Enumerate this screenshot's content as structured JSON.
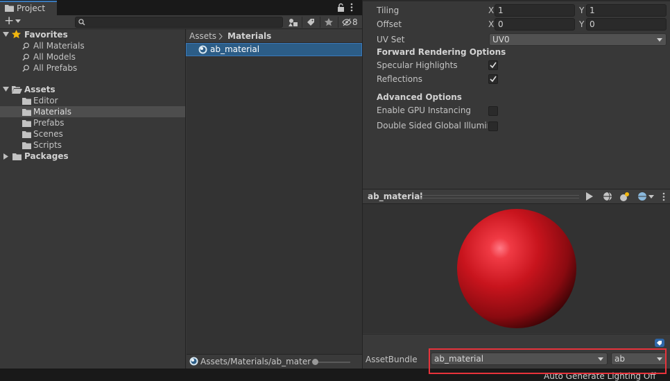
{
  "project": {
    "tab_label": "Project",
    "toolbar": {
      "add_label": "+",
      "search_placeholder": "",
      "hidden_count": "8"
    },
    "tree": {
      "favorites_label": "Favorites",
      "favorites": [
        "All Materials",
        "All Models",
        "All Prefabs"
      ],
      "assets_label": "Assets",
      "asset_folders": [
        "Editor",
        "Materials",
        "Prefabs",
        "Scenes",
        "Scripts"
      ],
      "selected_folder": "Materials",
      "packages_label": "Packages"
    },
    "breadcrumb": {
      "root": "Assets",
      "current": "Materials"
    },
    "asset_item": "ab_material",
    "status_path": "Assets/Materials/ab_materia"
  },
  "inspector": {
    "tiling_label": "Tiling",
    "tiling_x": "1",
    "tiling_y": "1",
    "offset_label": "Offset",
    "offset_x": "0",
    "offset_y": "0",
    "x_label": "X",
    "y_label": "Y",
    "uv_set_label": "UV Set",
    "uv_set_value": "UV0",
    "forward_header": "Forward Rendering Options",
    "specular_label": "Specular Highlights",
    "specular_checked": true,
    "reflections_label": "Reflections",
    "reflections_checked": true,
    "advanced_header": "Advanced Options",
    "gpu_instancing_label": "Enable GPU Instancing",
    "gpu_instancing_checked": false,
    "double_sided_label": "Double Sided Global Illumina",
    "double_sided_checked": false,
    "preview_title": "ab_material",
    "asset_bundle_label": "AssetBundle",
    "asset_bundle_name": "ab_material",
    "asset_bundle_variant": "ab"
  },
  "footer": {
    "lighting_status": "Auto Generate Lighting Off"
  },
  "colors": {
    "selection": "#2c5d87",
    "accent": "#3a79bb",
    "highlight_box": "#e8333b",
    "sphere": "#c0161e"
  }
}
